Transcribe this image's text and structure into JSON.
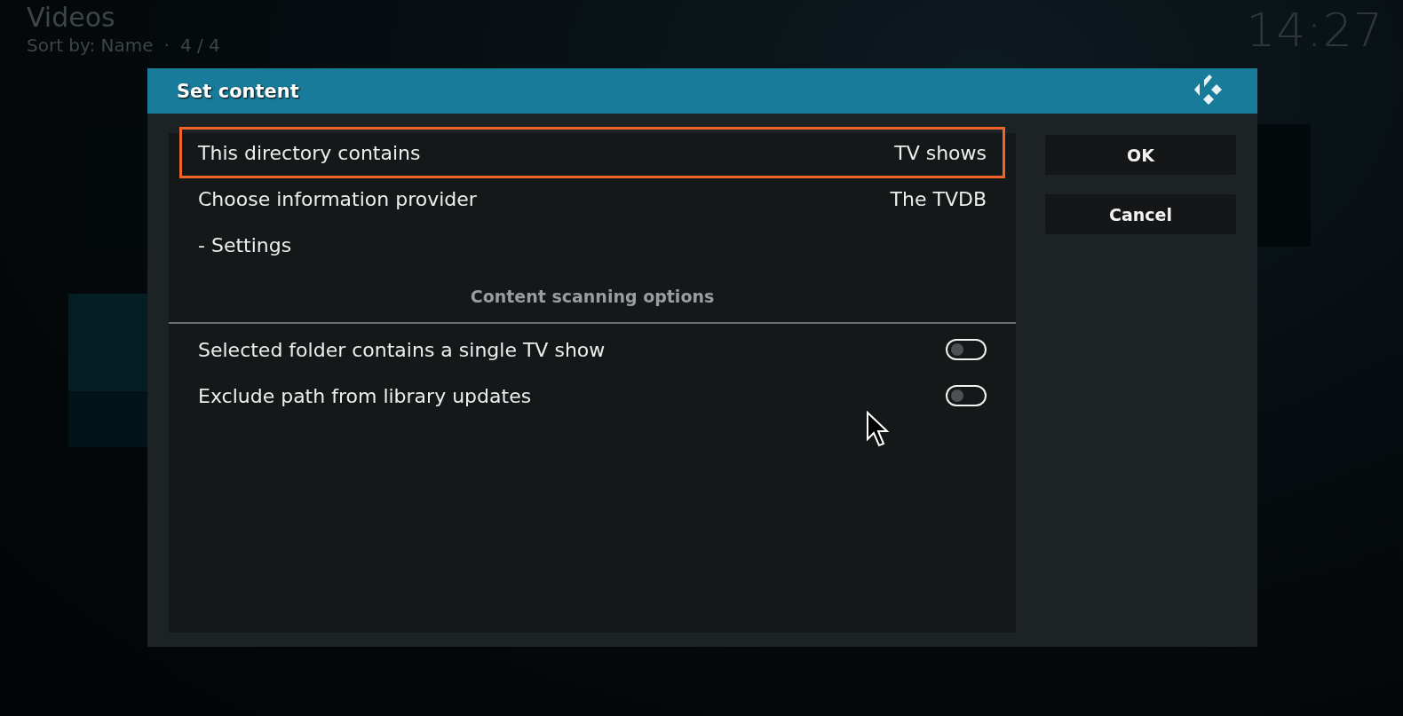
{
  "header": {
    "title": "Videos",
    "sort": "Sort by: Name",
    "separator": "·",
    "count": "4 / 4",
    "clock": "14:27"
  },
  "dialog": {
    "title": "Set content",
    "items": [
      {
        "kind": "option",
        "label": "This directory contains",
        "value": "TV shows",
        "selected": true
      },
      {
        "kind": "option",
        "label": "Choose information provider",
        "value": "The TVDB",
        "selected": false
      },
      {
        "kind": "option",
        "label": "- Settings",
        "selected": false
      },
      {
        "kind": "heading",
        "label": "Content scanning options"
      },
      {
        "kind": "toggle",
        "label": "Selected folder contains a single TV show",
        "on": false,
        "selected": false
      },
      {
        "kind": "toggle",
        "label": "Exclude path from library updates",
        "on": false,
        "selected": false
      }
    ],
    "buttons": [
      {
        "label": "OK"
      },
      {
        "label": "Cancel"
      }
    ]
  }
}
